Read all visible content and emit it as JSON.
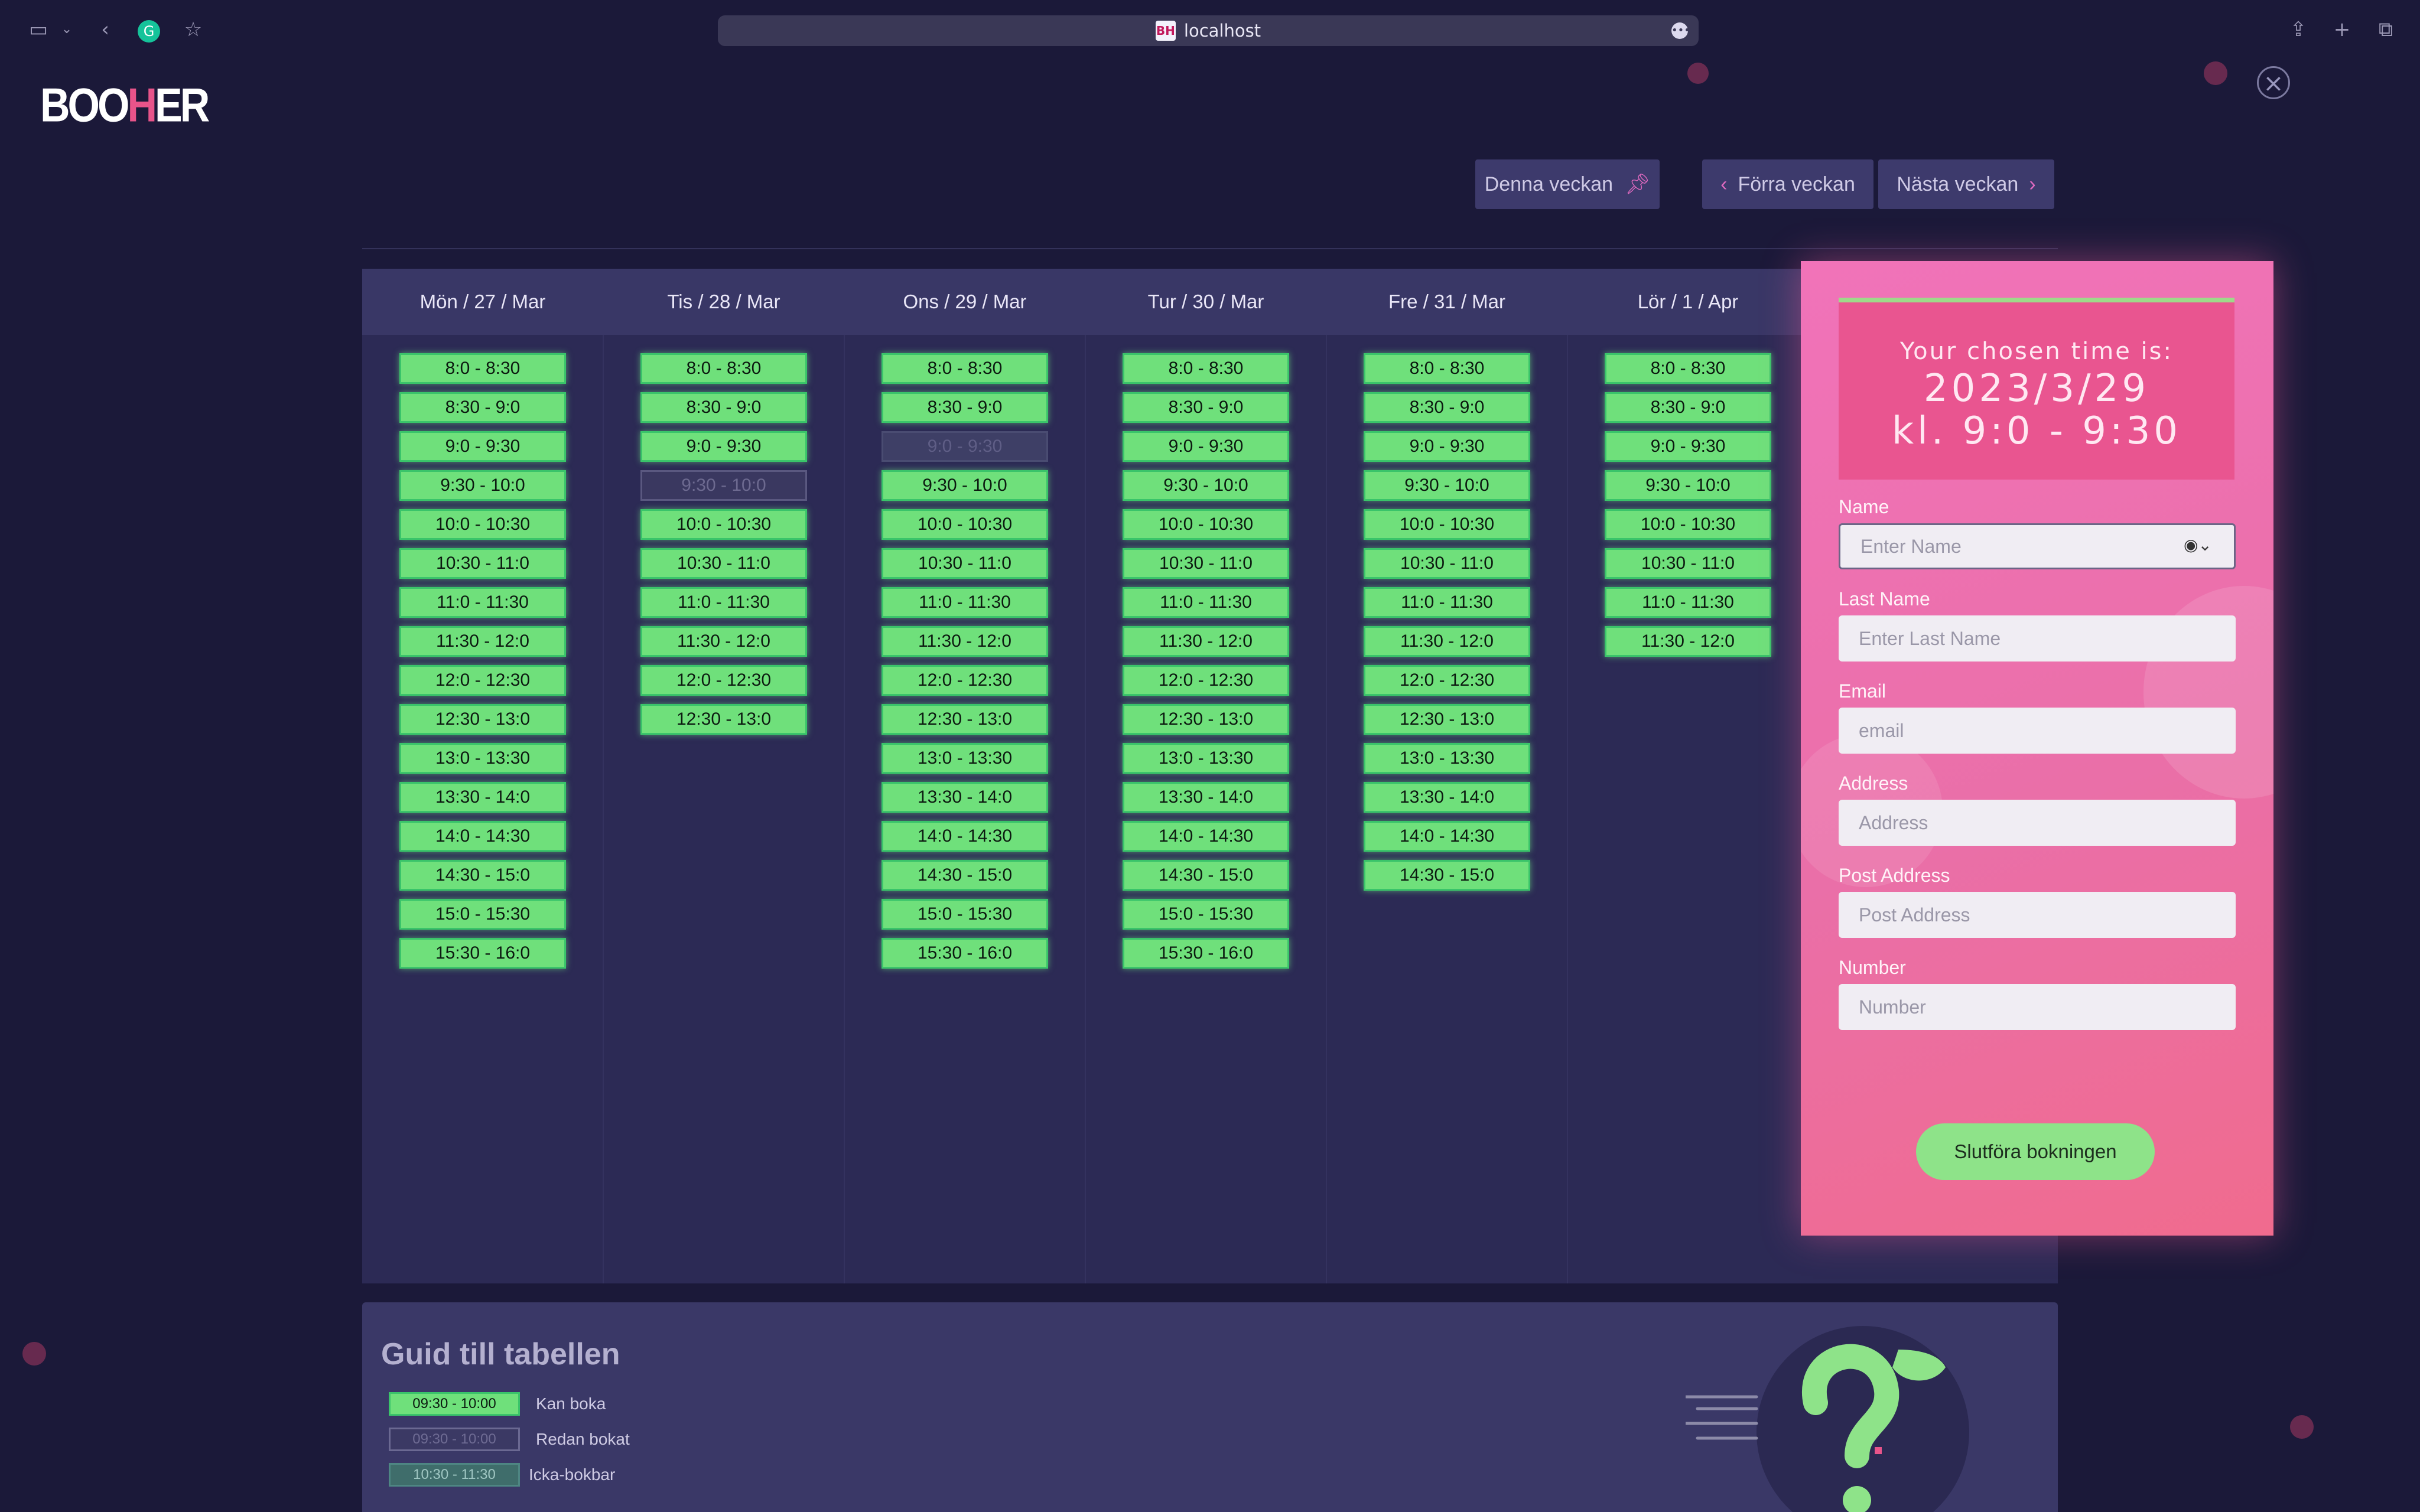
{
  "browser": {
    "url": "localhost",
    "favicon": "BH"
  },
  "logo": {
    "part1": "BOO",
    "part2": "H",
    "part3": "ER"
  },
  "nav": {
    "this_week": "Denna veckan",
    "prev_week": "Förra veckan",
    "next_week": "Nästa veckan"
  },
  "calendar": {
    "days": [
      {
        "title": "Mön / 27 / Mar",
        "slots": [
          {
            "label": "8:0 - 8:30",
            "state": "available"
          },
          {
            "label": "8:30 - 9:0",
            "state": "available"
          },
          {
            "label": "9:0 - 9:30",
            "state": "available"
          },
          {
            "label": "9:30 - 10:0",
            "state": "available"
          },
          {
            "label": "10:0 - 10:30",
            "state": "available"
          },
          {
            "label": "10:30 - 11:0",
            "state": "available"
          },
          {
            "label": "11:0 - 11:30",
            "state": "available"
          },
          {
            "label": "11:30 - 12:0",
            "state": "available"
          },
          {
            "label": "12:0 - 12:30",
            "state": "available"
          },
          {
            "label": "12:30 - 13:0",
            "state": "available"
          },
          {
            "label": "13:0 - 13:30",
            "state": "available"
          },
          {
            "label": "13:30 - 14:0",
            "state": "available"
          },
          {
            "label": "14:0 - 14:30",
            "state": "available"
          },
          {
            "label": "14:30 - 15:0",
            "state": "available"
          },
          {
            "label": "15:0 - 15:30",
            "state": "available"
          },
          {
            "label": "15:30 - 16:0",
            "state": "available"
          }
        ]
      },
      {
        "title": "Tis / 28 / Mar",
        "slots": [
          {
            "label": "8:0 - 8:30",
            "state": "available"
          },
          {
            "label": "8:30 - 9:0",
            "state": "available"
          },
          {
            "label": "9:0 - 9:30",
            "state": "available"
          },
          {
            "label": "9:30 - 10:0",
            "state": "booked"
          },
          {
            "label": "10:0 - 10:30",
            "state": "available"
          },
          {
            "label": "10:30 - 11:0",
            "state": "available"
          },
          {
            "label": "11:0 - 11:30",
            "state": "available"
          },
          {
            "label": "11:30 - 12:0",
            "state": "available"
          },
          {
            "label": "12:0 - 12:30",
            "state": "available"
          },
          {
            "label": "12:30 - 13:0",
            "state": "available"
          }
        ]
      },
      {
        "title": "Ons / 29 / Mar",
        "slots": [
          {
            "label": "8:0 - 8:30",
            "state": "available"
          },
          {
            "label": "8:30 - 9:0",
            "state": "available"
          },
          {
            "label": "9:0 - 9:30",
            "state": "unavailable"
          },
          {
            "label": "9:30 - 10:0",
            "state": "available"
          },
          {
            "label": "10:0 - 10:30",
            "state": "available"
          },
          {
            "label": "10:30 - 11:0",
            "state": "available"
          },
          {
            "label": "11:0 - 11:30",
            "state": "available"
          },
          {
            "label": "11:30 - 12:0",
            "state": "available"
          },
          {
            "label": "12:0 - 12:30",
            "state": "available"
          },
          {
            "label": "12:30 - 13:0",
            "state": "available"
          },
          {
            "label": "13:0 - 13:30",
            "state": "available"
          },
          {
            "label": "13:30 - 14:0",
            "state": "available"
          },
          {
            "label": "14:0 - 14:30",
            "state": "available"
          },
          {
            "label": "14:30 - 15:0",
            "state": "available"
          },
          {
            "label": "15:0 - 15:30",
            "state": "available"
          },
          {
            "label": "15:30 - 16:0",
            "state": "available"
          }
        ]
      },
      {
        "title": "Tur / 30 / Mar",
        "slots": [
          {
            "label": "8:0 - 8:30",
            "state": "available"
          },
          {
            "label": "8:30 - 9:0",
            "state": "available"
          },
          {
            "label": "9:0 - 9:30",
            "state": "available"
          },
          {
            "label": "9:30 - 10:0",
            "state": "available"
          },
          {
            "label": "10:0 - 10:30",
            "state": "available"
          },
          {
            "label": "10:30 - 11:0",
            "state": "available"
          },
          {
            "label": "11:0 - 11:30",
            "state": "available"
          },
          {
            "label": "11:30 - 12:0",
            "state": "available"
          },
          {
            "label": "12:0 - 12:30",
            "state": "available"
          },
          {
            "label": "12:30 - 13:0",
            "state": "available"
          },
          {
            "label": "13:0 - 13:30",
            "state": "available"
          },
          {
            "label": "13:30 - 14:0",
            "state": "available"
          },
          {
            "label": "14:0 - 14:30",
            "state": "available"
          },
          {
            "label": "14:30 - 15:0",
            "state": "available"
          },
          {
            "label": "15:0 - 15:30",
            "state": "available"
          },
          {
            "label": "15:30 - 16:0",
            "state": "available"
          }
        ]
      },
      {
        "title": "Fre / 31 / Mar",
        "slots": [
          {
            "label": "8:0 - 8:30",
            "state": "available"
          },
          {
            "label": "8:30 - 9:0",
            "state": "available"
          },
          {
            "label": "9:0 - 9:30",
            "state": "available"
          },
          {
            "label": "9:30 - 10:0",
            "state": "available"
          },
          {
            "label": "10:0 - 10:30",
            "state": "available"
          },
          {
            "label": "10:30 - 11:0",
            "state": "available"
          },
          {
            "label": "11:0 - 11:30",
            "state": "available"
          },
          {
            "label": "11:30 - 12:0",
            "state": "available"
          },
          {
            "label": "12:0 - 12:30",
            "state": "available"
          },
          {
            "label": "12:30 - 13:0",
            "state": "available"
          },
          {
            "label": "13:0 - 13:30",
            "state": "available"
          },
          {
            "label": "13:30 - 14:0",
            "state": "available"
          },
          {
            "label": "14:0 - 14:30",
            "state": "available"
          },
          {
            "label": "14:30 - 15:0",
            "state": "available"
          }
        ]
      },
      {
        "title": "Lör / 1 / Apr",
        "slots": [
          {
            "label": "8:0 - 8:30",
            "state": "available"
          },
          {
            "label": "8:30 - 9:0",
            "state": "available"
          },
          {
            "label": "9:0 - 9:30",
            "state": "available"
          },
          {
            "label": "9:30 - 10:0",
            "state": "available"
          },
          {
            "label": "10:0 - 10:30",
            "state": "available"
          },
          {
            "label": "10:30 - 11:0",
            "state": "available"
          },
          {
            "label": "11:0 - 11:30",
            "state": "available"
          },
          {
            "label": "11:30 - 12:0",
            "state": "available"
          }
        ]
      }
    ]
  },
  "booking": {
    "chosen_label": "Your chosen time is:",
    "chosen_date": "2023/3/29",
    "chosen_time": "kl. 9:0 - 9:30",
    "fields": [
      {
        "label": "Name",
        "placeholder": "Enter Name"
      },
      {
        "label": "Last Name",
        "placeholder": "Enter Last Name"
      },
      {
        "label": "Email",
        "placeholder": "email"
      },
      {
        "label": "Address",
        "placeholder": "Address"
      },
      {
        "label": "Post Address",
        "placeholder": "Post Address"
      },
      {
        "label": "Number",
        "placeholder": "Number"
      }
    ],
    "submit": "Slutföra bokningen"
  },
  "guide": {
    "title": "Guid till tabellen",
    "items": [
      {
        "slot": "09:30 - 10:00",
        "label": "Kan boka",
        "state": "ok"
      },
      {
        "slot": "09:30 - 10:00",
        "label": "Redan bokat",
        "state": "booked"
      },
      {
        "slot": "10:30 - 11:30",
        "label": "Icka-bokbar",
        "state": "na"
      }
    ]
  },
  "colors": {
    "background": "#1b1939",
    "available": "#6fe07b",
    "panel": "#ea6fa8",
    "accent": "#e8548a"
  }
}
